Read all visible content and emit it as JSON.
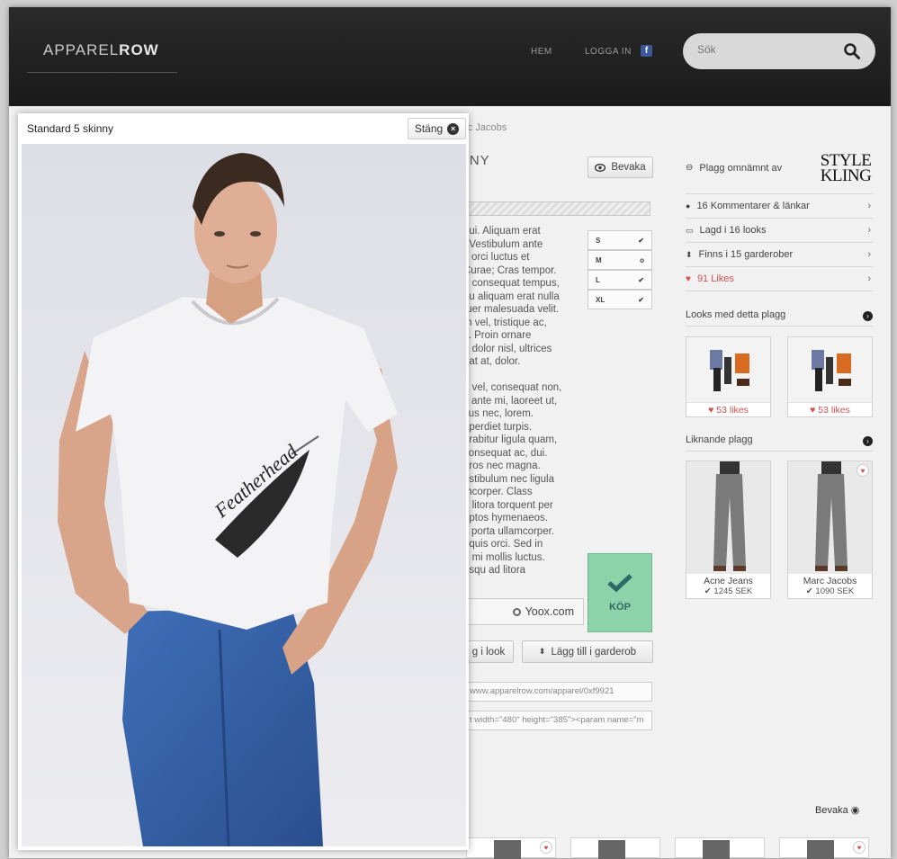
{
  "header": {
    "logo_light": "APPAREL",
    "logo_bold": "ROW",
    "nav_home": "HEM",
    "nav_login": "LOGGA IN",
    "facebook": "f",
    "search_placeholder": "Sök"
  },
  "product": {
    "breadcrumb": "arc Jacobs",
    "title_partial": "NNY",
    "watch_label": "Bevaka",
    "description": "dui. Aliquam erat\n. Vestibulum ante\ns orci luctus et\nCurae; Cras tempor.\nn consequat tempus,\neu aliquam erat nulla\ntuer malesuada velit.\nm vel, tristique ac,\ns. Proin ornare\ne dolor nisl, ultrices\nuat at, dolor.\n\nd vel, consequat non,\ns ante mi, laoreet ut,\nsus nec, lorem.\nnperdiet turpis.\nurabitur ligula quam,\nconsequat ac, dui.\neros nec magna.\nestibulum nec ligula\nmcorper. Class\nd litora torquent per\neptos hymenaeos.\nit porta ullamcorper.\nt quis orci. Sed in\nu mi mollis luctus.\nosqu ad litora",
    "sizes": [
      {
        "label": "S",
        "status": "✔"
      },
      {
        "label": "M",
        "status": "o"
      },
      {
        "label": "L",
        "status": "✔"
      },
      {
        "label": "XL",
        "status": "✔"
      }
    ],
    "store": "Yoox.com",
    "buy_label": "KÖP",
    "add_look_label": "g i look",
    "add_wardrobe_label": "Lägg till i garderob",
    "url": "www.apparelrow.com/apparel/0xf9921",
    "embed_code": "t width=\"480\" height=\"385\"><param name=\"m"
  },
  "sidebar": {
    "mentioned_by": "Plagg omnämnt av",
    "brand_logo": "STYLE by KLING",
    "rows": [
      {
        "label": "16 Kommentarer & länkar"
      },
      {
        "label": "Lagd i 16 looks"
      },
      {
        "label": "Finns i 15 garderober"
      },
      {
        "label": "91 Likes"
      }
    ],
    "looks_heading": "Looks med detta plagg",
    "looks": [
      {
        "likes": "53 likes"
      },
      {
        "likes": "53 likes"
      }
    ],
    "similar_heading": "Liknande plagg",
    "similar": [
      {
        "name": "Acne Jeans",
        "price": "1245 SEK"
      },
      {
        "name": "Marc Jacobs",
        "price": "1090 SEK"
      }
    ]
  },
  "bottom": {
    "watch_label": "Bevaka"
  },
  "modal": {
    "title": "Standard 5 skinny",
    "close_label": "Stäng",
    "print_text": "Featherhead"
  }
}
